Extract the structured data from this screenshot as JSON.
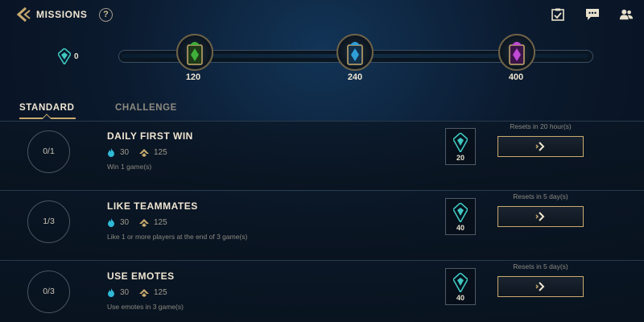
{
  "header": {
    "title": "MISSIONS",
    "help_label": "?"
  },
  "currency": {
    "value": "0"
  },
  "progress": {
    "fill_fraction": 0.0,
    "milestones": [
      {
        "value": "120",
        "color": "#3fae3a"
      },
      {
        "value": "240",
        "color": "#2f9fd8"
      },
      {
        "value": "400",
        "color": "#c04ad6"
      }
    ]
  },
  "tabs": [
    {
      "label": "STANDARD",
      "active": true
    },
    {
      "label": "CHALLENGE",
      "active": false
    }
  ],
  "missions": [
    {
      "progress": "0/1",
      "name": "DAILY FIRST WIN",
      "xp": "30",
      "tokens": "125",
      "description": "Win 1 game(s)",
      "reward": "20",
      "reset": "Resets in 20 hour(s)"
    },
    {
      "progress": "1/3",
      "name": "LIKE TEAMMATES",
      "xp": "30",
      "tokens": "125",
      "description": "Like 1 or more players at the end of 3 game(s)",
      "reward": "40",
      "reset": "Resets in 5 day(s)"
    },
    {
      "progress": "0/3",
      "name": "USE EMOTES",
      "xp": "30",
      "tokens": "125",
      "description": "Use emotes in 3 game(s)",
      "reward": "40",
      "reset": "Resets in 5 day(s)"
    }
  ],
  "colors": {
    "accent_gold": "#c8aa6e",
    "xp_blue": "#2fb9d6",
    "token_gold": "#c8aa6e",
    "reward_teal": "#3fc7c0"
  }
}
